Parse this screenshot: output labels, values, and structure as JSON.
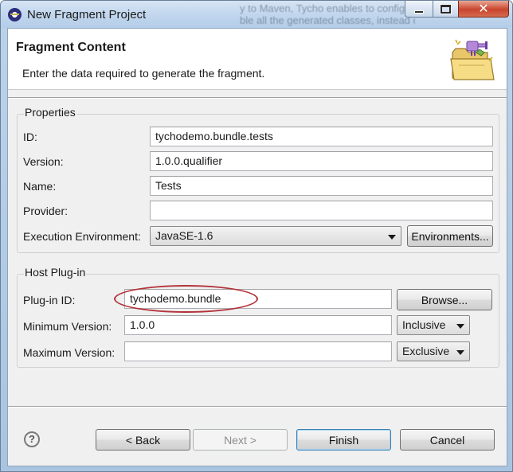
{
  "window": {
    "title": "New Fragment Project",
    "background_text": [
      "y to Maven, Tycho enables to configure",
      "ble all the generated classes, instead of having to maintain different projects, remote bundle with test-scoped dependencies in MANIFEST"
    ]
  },
  "banner": {
    "title": "Fragment Content",
    "description": "Enter the data required to generate the fragment.",
    "icon": "folder-plugin-icon"
  },
  "properties": {
    "group_title": "Properties",
    "id_label": "ID:",
    "id_value": "tychodemo.bundle.tests",
    "version_label": "Version:",
    "version_value": "1.0.0.qualifier",
    "name_label": "Name:",
    "name_value": "Tests",
    "provider_label": "Provider:",
    "provider_value": "",
    "ee_label": "Execution Environment:",
    "ee_value": "JavaSE-1.6",
    "environments_button": "Environments..."
  },
  "host": {
    "group_title": "Host Plug-in",
    "plugin_id_label": "Plug-in ID:",
    "plugin_id_value": "tychodemo.bundle",
    "browse_button": "Browse...",
    "min_version_label": "Minimum Version:",
    "min_version_value": "1.0.0",
    "min_version_mode": "Inclusive",
    "max_version_label": "Maximum Version:",
    "max_version_value": "",
    "max_version_mode": "Exclusive"
  },
  "footer": {
    "back_button": "< Back",
    "next_button": "Next >",
    "finish_button": "Finish",
    "cancel_button": "Cancel",
    "help_icon": "help-icon"
  },
  "colors": {
    "highlight_ellipse": "#b3323a",
    "close_button": "#c8452e"
  }
}
